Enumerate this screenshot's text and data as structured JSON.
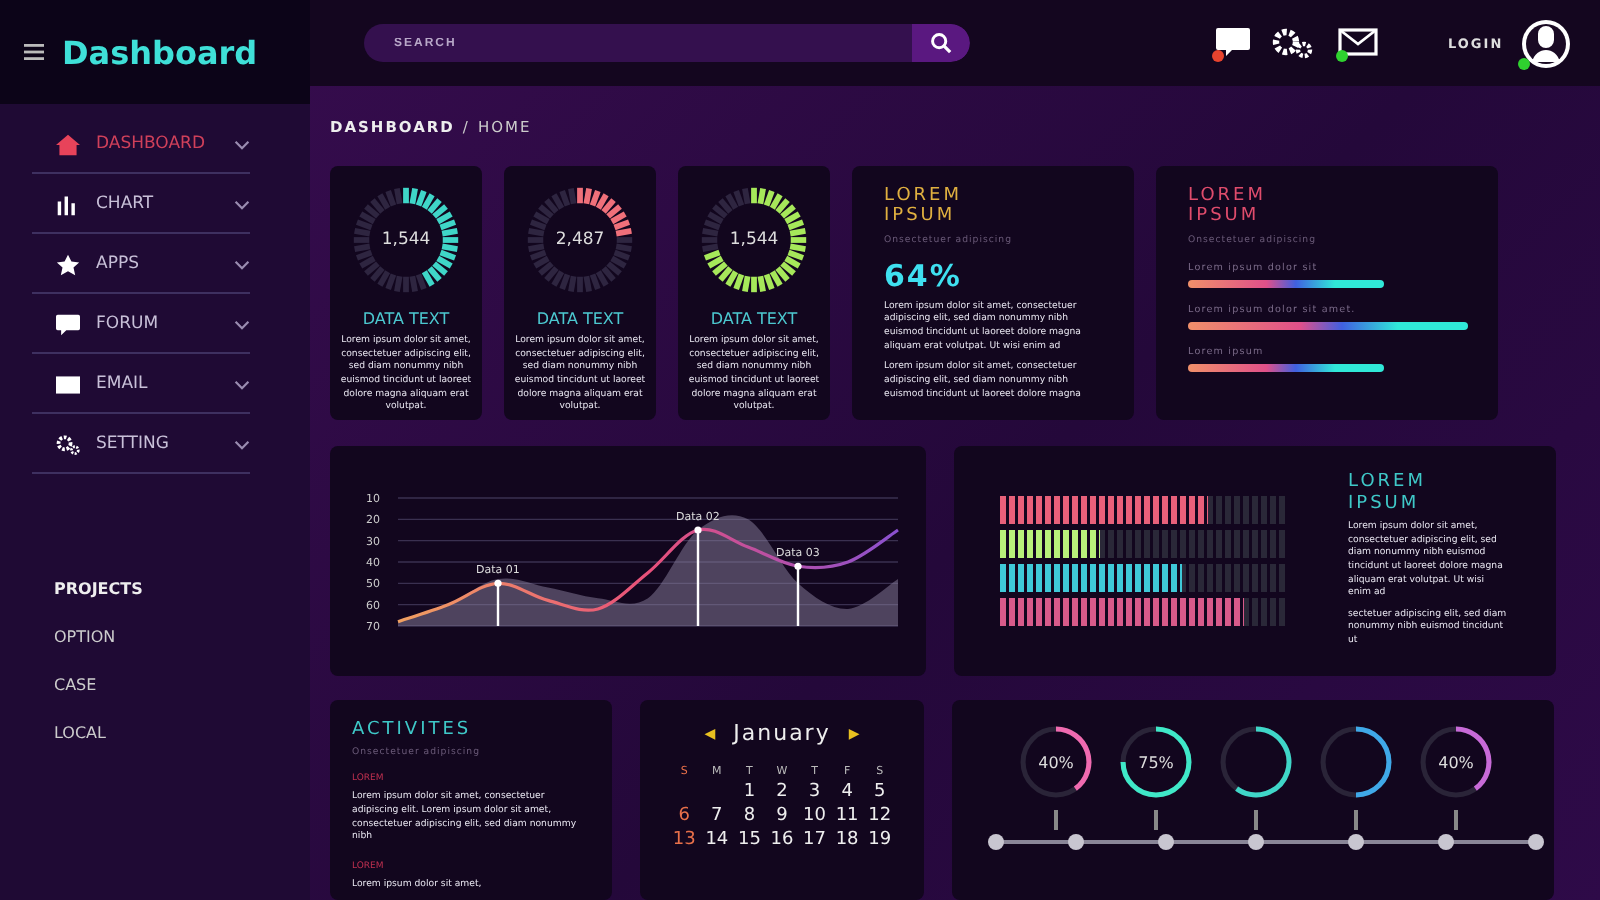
{
  "app": {
    "title": "Dashboard"
  },
  "search": {
    "placeholder": "SEARCH"
  },
  "header_icons": [
    {
      "kind": "chat",
      "color": "#e8432e"
    },
    {
      "kind": "gears"
    },
    {
      "kind": "mail",
      "color": "#2fd12f"
    }
  ],
  "login": {
    "label": "LOGIN",
    "color": "#2fd12f"
  },
  "sidebar": {
    "items": [
      {
        "kind": "home",
        "label": "DASHBOARD",
        "selected": true
      },
      {
        "kind": "chart",
        "label": "CHART",
        "selected": false
      },
      {
        "kind": "star",
        "label": "APPS",
        "selected": false
      },
      {
        "kind": "chat",
        "label": "FORUM",
        "selected": false
      },
      {
        "kind": "mail",
        "label": "EMAIL",
        "selected": false
      },
      {
        "kind": "gears",
        "label": "SETTING",
        "selected": false
      }
    ],
    "section_title": "PROJECTS",
    "projects": [
      "OPTION",
      "CASE",
      "LOCAL"
    ]
  },
  "breadcrumb": {
    "current": "DASHBOARD",
    "separator": "/",
    "parent": "HOME"
  },
  "stat_cards": [
    {
      "value": "1,544",
      "level": 0.45,
      "color": "#3fd6c8",
      "title": "DATA TEXT",
      "text": "Lorem ipsum dolor sit amet, consectetuer adipiscing elit, sed diam nonummy nibh euismod tincidunt ut laoreet dolore magna aliquam erat volutpat."
    },
    {
      "value": "2,487",
      "level": 0.25,
      "color": "#f0707a",
      "title": "DATA TEXT",
      "text": "Lorem ipsum dolor sit amet, consectetuer adipiscing elit, sed diam nonummy nibh euismod tincidunt ut laoreet dolore magna aliquam erat volutpat."
    },
    {
      "value": "1,544",
      "level": 0.72,
      "color": "#a6e85a",
      "title": "DATA TEXT",
      "text": "Lorem ipsum dolor sit amet, consectetuer adipiscing elit, sed diam nonummy nibh euismod tincidunt ut laoreet dolore magna aliquam erat volutpat."
    }
  ],
  "percent_card": {
    "title": "LOREM IPSUM",
    "subtitle": "Onsectetuer adipiscing",
    "value": "64%",
    "paragraphs": [
      "Lorem ipsum dolor sit amet, consectetuer adipiscing elit, sed diam nonummy nibh euismod tincidunt ut laoreet dolore magna aliquam erat volutpat. Ut wisi enim ad",
      "Lorem ipsum dolor sit amet, consectetuer adipiscing elit, sed diam nonummy nibh euismod tincidunt ut laoreet dolore magna"
    ]
  },
  "progress_card": {
    "title": "LOREM IPSUM",
    "subtitle": "Onsectetuer adipiscing",
    "bars": [
      {
        "label": "Lorem ipsum dolor sit"
      },
      {
        "label": "Lorem ipsum dolor sit amet."
      },
      {
        "label": "Lorem ipsum"
      }
    ]
  },
  "line_card": {
    "axis_labels": [
      "10",
      "20",
      "30",
      "40",
      "50",
      "60",
      "70"
    ],
    "point_labels": [
      "Data 01",
      "Data 02",
      "Data 03"
    ]
  },
  "meter_card": {
    "rows": [
      {
        "level": 0.72,
        "color": "#e8607a"
      },
      {
        "level": 0.35,
        "color": "#b8f07a"
      },
      {
        "level": 0.63,
        "color": "#3fc8d8"
      },
      {
        "level": 0.85,
        "color": "#d85a8a"
      }
    ],
    "title": "LOREM IPSUM",
    "paragraphs": [
      "Lorem ipsum dolor sit amet, consectetuer adipiscing elit, sed diam nonummy nibh euismod tincidunt ut laoreet dolore magna aliquam erat volutpat. Ut wisi enim ad",
      "sectetuer adipiscing elit, sed diam nonummy nibh euismod tincidunt ut"
    ]
  },
  "activities": {
    "title": "ACTIVITES",
    "subtitle": "Onsectetuer adipiscing",
    "entries": [
      {
        "heading": "LOREM",
        "text": "Lorem ipsum dolor sit amet, consectetuer adipiscing elit. Lorem ipsum dolor sit amet, consectetuer adipiscing elit, sed diam nonummy nibh"
      },
      {
        "heading": "LOREM",
        "text": "Lorem ipsum dolor sit amet,"
      }
    ]
  },
  "calendar": {
    "prev": "◀",
    "month": "January",
    "next": "▶",
    "weekdays": [
      "S",
      "M",
      "T",
      "W",
      "T",
      "F",
      "S"
    ],
    "weeks": [
      [
        "1",
        "2",
        "3",
        "4",
        "5"
      ],
      [
        "6",
        "7",
        "8",
        "9",
        "10",
        "11",
        "12"
      ],
      [
        "13",
        "14",
        "15",
        "16",
        "17",
        "18",
        "19"
      ]
    ]
  },
  "rings": [
    {
      "label": "40%",
      "color": "#f06ab0"
    },
    {
      "label": "75%",
      "color": "#3fe8c8"
    },
    {
      "color": "#3fd6c8"
    },
    {
      "color": "#3fa8e8"
    },
    {
      "label": "40%",
      "color": "#c86ad8"
    }
  ]
}
